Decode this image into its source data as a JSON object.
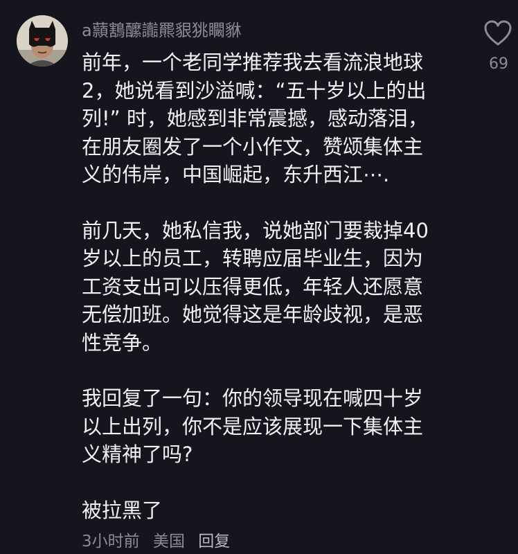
{
  "comment": {
    "username": "a蘏鶷醿讟羆貇狣矙貅",
    "like_count": "69",
    "paragraphs": [
      {
        "lines": [
          "前年，一个老同学推荐我去看流浪地球",
          "2，她说看到沙溢喊：“五十岁以上的出",
          "列!” 时，她感到非常震撼，感动落泪，",
          "在朋友圈发了一个小作文，赞颂集体主",
          "义的伟岸，中国崛起，东升西江⋯."
        ]
      },
      {
        "lines": [
          "前几天，她私信我，说她部门要裁掉40",
          "岁以上的员工，转聘应届毕业生，因为",
          "工资支出可以压得更低，年轻人还愿意",
          "无偿加班。她觉得这是年龄歧视，是恶",
          "性竞争。"
        ]
      },
      {
        "lines": [
          "我回复了一句：你的领导现在喊四十岁",
          "以上出列，你不是应该展现一下集体主",
          "义精神了吗?"
        ]
      },
      {
        "lines": [
          "被拉黑了"
        ]
      }
    ],
    "meta": {
      "time": "3小时前",
      "location": "美国",
      "reply_label": "回复"
    }
  },
  "icons": {
    "like": "heart-outline-icon",
    "avatar": "batman-mask-avatar"
  },
  "colors": {
    "background": "#16151d",
    "text": "#f2f2f4",
    "secondary_text": "#8c8b96"
  }
}
